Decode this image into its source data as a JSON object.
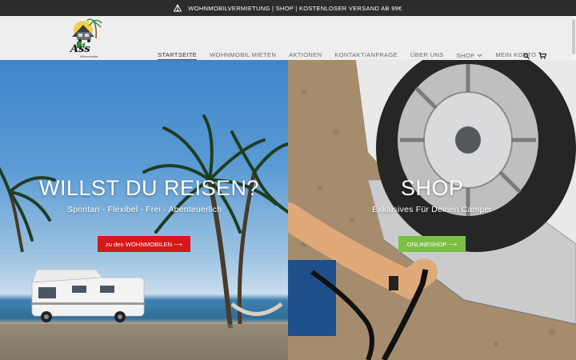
{
  "topbar": {
    "text": "WOHNMOBILVERMIETUNG | SHOP | KOSTENLOSER VERSAND AB 99€",
    "icon": "tent-icon"
  },
  "logo": {
    "text": "Ass",
    "subtext": "Wohnmobile"
  },
  "nav": {
    "items": [
      "STARTSEITE",
      "WOHNMOBIL MIETEN",
      "AKTIONEN",
      "KONTAKT/ANFRAGE",
      "ÜBER UNS",
      "SHOP",
      "MEIN KONTO"
    ],
    "active": "STARTSEITE",
    "icons": [
      "search-icon",
      "cart-icon"
    ]
  },
  "left": {
    "title": "WILLST DU REISEN?",
    "subtitle": "Spontan - Flexibel - Frei - Abenteuerlich",
    "button": "zu den WOHNMOBILEN ⟶",
    "button_color": "#d6181a"
  },
  "right": {
    "title": "SHOP",
    "subtitle": "Exklusives Für Deinen Camper",
    "button": "ONLINESHOP ⟶",
    "button_color": "#7bbf44"
  }
}
